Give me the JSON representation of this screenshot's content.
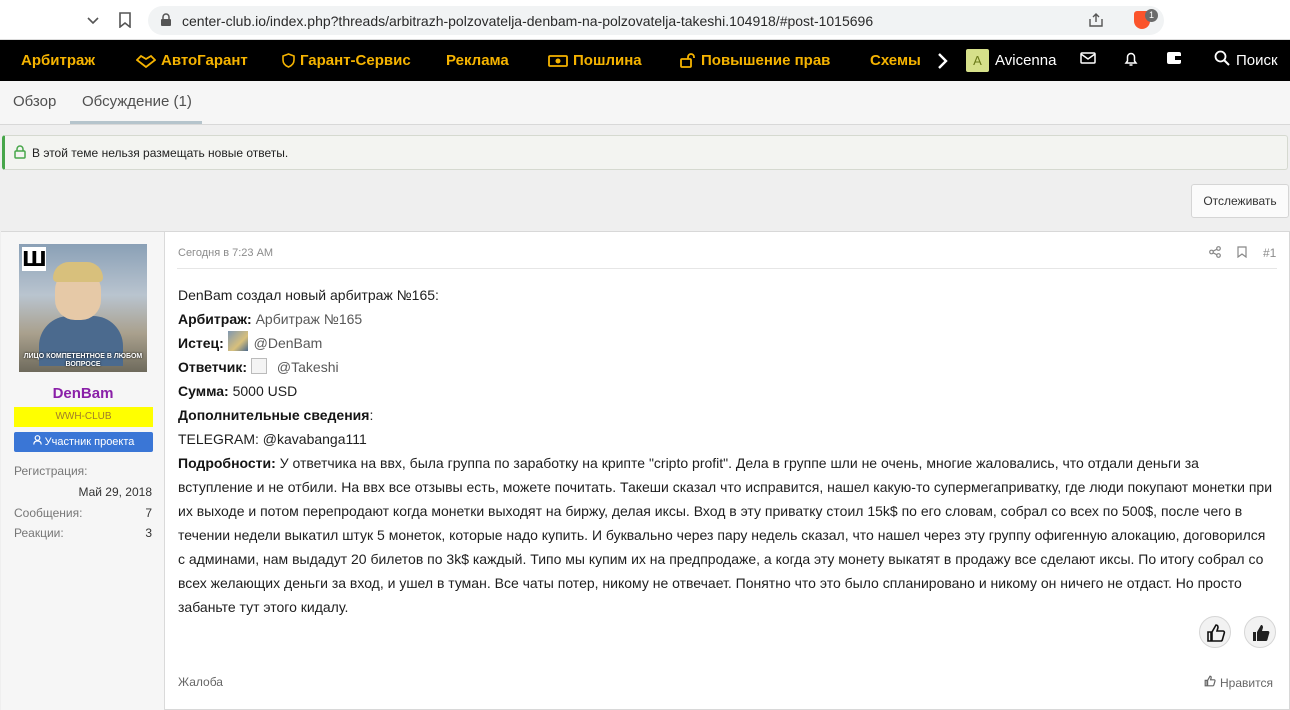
{
  "browser": {
    "url": "center-club.io/index.php?threads/arbitrazh-polzovatelja-denbam-na-polzovatelja-takeshi.104918/#post-1015696",
    "extension_badge": "1"
  },
  "nav": {
    "items": [
      "Арбитраж",
      "АвтоГарант",
      "Гарант-Сервис",
      "Реклама",
      "Пошлина",
      "Повышение прав",
      "Схемы"
    ],
    "username": "Avicenna",
    "avatar_letter": "A",
    "search_label": "Поиск",
    "accent_color": "#f5b300"
  },
  "tabs": [
    {
      "label": "Обзор",
      "active": false
    },
    {
      "label": "Обсуждение (1)",
      "active": true
    }
  ],
  "notice": {
    "text": "В этой теме нельзя размещать новые ответы."
  },
  "watch_button": "Отслеживать",
  "post": {
    "avatar_caption": "ЛИЦО КОМПЕТЕНТНОЕ В ЛЮБОМ ВОПРОСЕ",
    "avatar_logo": "Ш",
    "username": "DenBam",
    "banner": "WWH-CLUB",
    "role": "Участник проекта",
    "stats": [
      {
        "label": "Регистрация:",
        "value": "Май 29, 2018"
      },
      {
        "label": "Сообщения:",
        "value": "7"
      },
      {
        "label": "Реакции:",
        "value": "3"
      }
    ],
    "date": "Сегодня в 7:23 AM",
    "number": "#1",
    "intro": "DenBam создал новый арбитраж №165:",
    "arb_label": "Арбитраж:",
    "arb_value": "Арбитраж №165",
    "plaintiff_label": "Истец:",
    "plaintiff_value": "@DenBam",
    "defendant_label": "Ответчик:",
    "defendant_value": "@Takeshi",
    "sum_label": "Сумма:",
    "sum_value": "5000 USD",
    "extra_label": "Дополнительные сведения",
    "telegram": "TELEGRAM: @kavabanga111",
    "details_label": "Подробности:",
    "details_text": "У ответчика на ввх, была группа по заработку на крипте \"cripto profit\". Дела в группе шли не очень, многие жаловались, что отдали деньги за вступление и не отбили. На ввх все отзывы есть, можете почитать. Такеши сказал что исправится, нашел какую-то супермегаприватку, где люди покупают монетки при их выходе и потом перепродают когда монетки выходят на биржу, делая иксы. Вход в эту приватку стоил 15k$ по его словам, собрал со всех по 500$, после чего в течении недели выкатил штук 5 монеток, которые надо купить. И буквально через пару недель сказал, что нашел через эту группу офигенную алокацию, договорился с админами, нам выдадут 20 билетов по 3k$ каждый. Типо мы купим их на предпродаже, а когда эту монету выкатят в продажу все сделают иксы. По итогу собрал со всех желающих деньги за вход, и ушел в туман. Все чаты потер, никому не отвечает. Понятно что это было спланировано и никому он ничего не отдаст. Но просто забаньте тут этого кидалу.",
    "report": "Жалоба",
    "like": "Нравится"
  }
}
